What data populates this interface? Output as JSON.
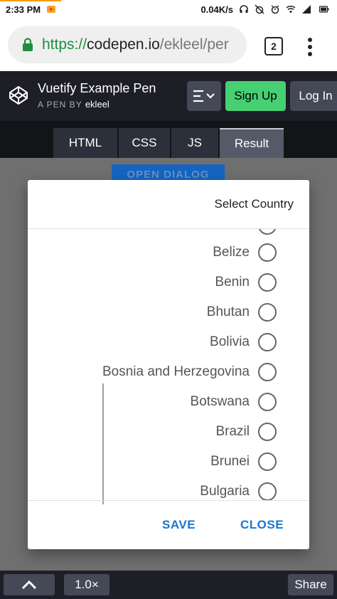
{
  "status_bar": {
    "time": "2:33 PM",
    "speed": "0.04K/s",
    "icons": [
      "headset-icon",
      "alarm-off-icon",
      "alarm-icon",
      "wifi-icon",
      "signal-icon",
      "battery-icon"
    ]
  },
  "browser": {
    "url_scheme": "https://",
    "url_host": "codepen.io",
    "url_path": "/ekleel/per",
    "tabs_count": "2"
  },
  "codepen": {
    "title": "Vuetify Example Pen",
    "byline_prefix": "A PEN BY",
    "author": "ekleel",
    "signup_label": "Sign Up",
    "login_label": "Log In",
    "tabs": [
      {
        "label": "HTML"
      },
      {
        "label": "CSS"
      },
      {
        "label": "JS"
      },
      {
        "label": "Result"
      }
    ],
    "active_tab": "Result",
    "open_dialog_label": "OPEN DIALOG"
  },
  "dialog": {
    "title": "Select Country",
    "countries": [
      "Belize",
      "Benin",
      "Bhutan",
      "Bolivia",
      "Bosnia and Herzegovina",
      "Botswana",
      "Brazil",
      "Brunei",
      "Bulgaria"
    ],
    "save_label": "SAVE",
    "close_label": "CLOSE"
  },
  "bottom_bar": {
    "zoom": "1.0×",
    "share_label": "Share"
  },
  "colors": {
    "accent_blue": "#1976d2",
    "signup_green": "#47cf73",
    "header_dark": "#1e1f26"
  }
}
